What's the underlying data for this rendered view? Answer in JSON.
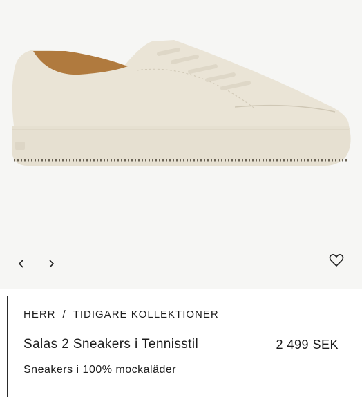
{
  "gallery": {
    "image_alt": "Salas 2 Sneakers i Tennisstil",
    "prev_icon": "chevron-left-icon",
    "next_icon": "chevron-right-icon",
    "favorite_icon": "heart-icon"
  },
  "breadcrumb": {
    "items": [
      "HERR",
      "TIDIGARE KOLLEKTIONER"
    ],
    "separator": "/"
  },
  "product": {
    "name": "Salas 2 Sneakers i Tennisstil",
    "price": "2 499 SEK",
    "description": "Sneakers i 100% mockaläder"
  },
  "colors": {
    "background": "#f6f6f4",
    "shoe": "#e8e2d3",
    "lining": "#b07a3e"
  }
}
